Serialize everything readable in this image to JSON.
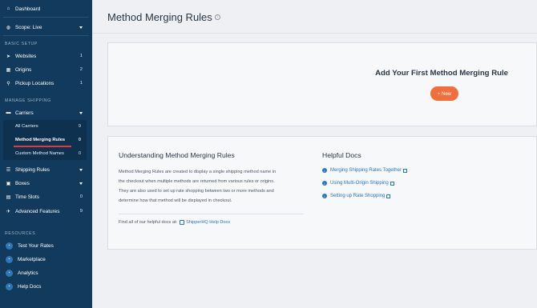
{
  "sidebar": {
    "dashboard": "Dashboard",
    "scope": "Scope: Live",
    "sections": {
      "basic_setup": "BASIC SETUP",
      "manage_shipping": "MANAGE SHIPPING",
      "resources": "RESOURCES"
    },
    "websites": {
      "label": "Websites",
      "count": "1"
    },
    "origins": {
      "label": "Origins",
      "count": "2"
    },
    "pickup_locations": {
      "label": "Pickup Locations",
      "count": "1"
    },
    "carriers": {
      "label": "Carriers"
    },
    "all_carriers": {
      "label": "All Carriers",
      "count": "9"
    },
    "method_merging_rules": {
      "label": "Method Merging Rules",
      "count": "0"
    },
    "custom_method_names": {
      "label": "Custom Method Names",
      "count": "0"
    },
    "shipping_rules": {
      "label": "Shipping Rules"
    },
    "boxes": {
      "label": "Boxes"
    },
    "time_slots": {
      "label": "Time Slots",
      "count": "0"
    },
    "advanced_features": {
      "label": "Advanced Features",
      "count": "9"
    },
    "test_rates": "Test Your Rates",
    "marketplace": "Marketplace",
    "analytics": "Analytics",
    "help_docs": "Help Docs"
  },
  "main": {
    "title": "Method Merging Rules",
    "empty_state_title": "Add Your First Method Merging Rule",
    "new_button": "+ New",
    "understanding": {
      "heading": "Understanding Method Merging Rules",
      "line1": "Method Merging Rules are created to display a single shipping method name in",
      "line2": "the checkout when multiple methods are returned from various rules or origins.",
      "line3": "They are also used to set up rate shopping between two or more methods and",
      "line4": "determine how that method will be displayed in checkout.",
      "find_label": "Find all of our helpful docs at:",
      "find_link": "ShipperHQ Help Docs"
    },
    "helpful_docs": {
      "heading": "Helpful Docs",
      "items": [
        "Merging Shipping Rates Together",
        "Using Multi-Origin Shipping",
        "Setting up Rate Shopping"
      ]
    }
  },
  "colors": {
    "sidebar_bg": "#123a5c",
    "accent_orange": "#f26f3b",
    "link_blue": "#2577c4",
    "active_underline": "#e23a3a"
  }
}
